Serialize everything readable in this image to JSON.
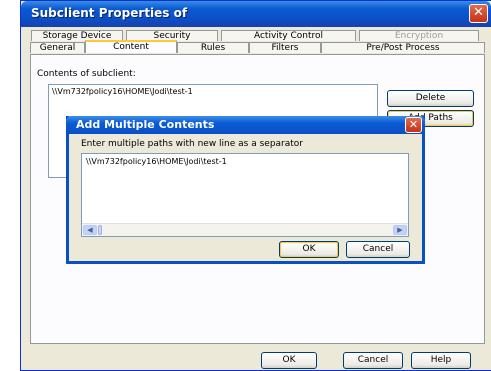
{
  "window": {
    "title": "Subclient Properties of",
    "close_glyph": "✕"
  },
  "tabs": {
    "row_top": [
      {
        "label": "Storage Device"
      },
      {
        "label": "Security"
      },
      {
        "label": "Activity Control"
      },
      {
        "label": "Encryption"
      }
    ],
    "row_bottom": [
      {
        "label": "General"
      },
      {
        "label": "Content"
      },
      {
        "label": "Rules"
      },
      {
        "label": "Filters"
      },
      {
        "label": "Pre/Post Process"
      }
    ],
    "active": "Content"
  },
  "content": {
    "contents_label": "Contents of subclient:",
    "entries": [
      "\\\\Vm732fpolicy16\\HOME\\Jodi\\test-1"
    ],
    "delete_button": "Delete",
    "add_paths_button": "Add Paths"
  },
  "dialog": {
    "title": "Add Multiple Contents",
    "close_glyph": "✕",
    "instruction": "Enter multiple paths with new line as a separator",
    "text_value": "\\\\Vm732fpolicy16\\HOME\\Jodi\\test-1",
    "scroll_left_glyph": "◀",
    "scroll_right_glyph": "▶",
    "ok_button": "OK",
    "cancel_button": "Cancel"
  },
  "footer": {
    "ok_button": "OK",
    "cancel_button": "Cancel",
    "help_button": "Help"
  }
}
